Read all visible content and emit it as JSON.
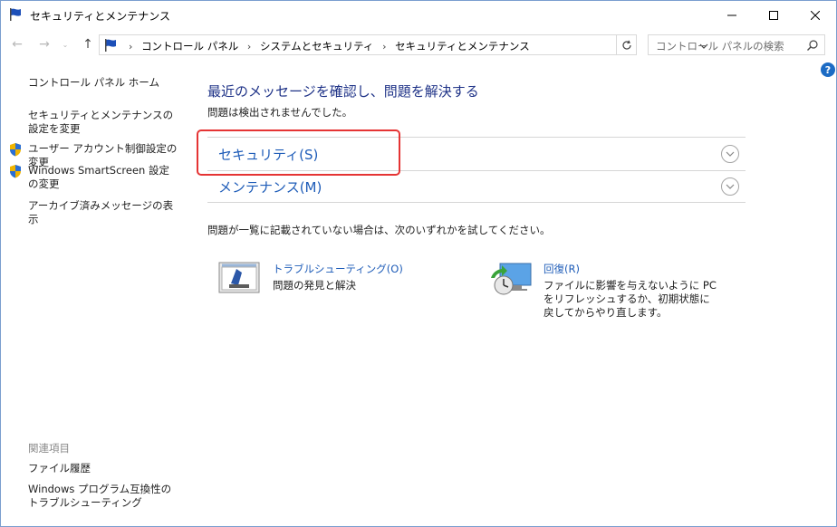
{
  "window": {
    "title": "セキュリティとメンテナンス"
  },
  "titlebar_buttons": {
    "minimize_glyph": "—",
    "maximize_glyph": "☐",
    "close_glyph": "✕"
  },
  "navigation": {
    "back_glyph": "←",
    "forward_glyph": "→",
    "recent_glyph": "⌄",
    "up_glyph": "↑",
    "breadcrumbs": [
      "コントロール パネル",
      "システムとセキュリティ",
      "セキュリティとメンテナンス"
    ],
    "breadcrumb_separator": "›",
    "search_placeholder": "コントロール パネルの検索"
  },
  "help": {
    "glyph": "?"
  },
  "sidebar": {
    "home": "コントロール パネル ホーム",
    "items": [
      {
        "label": "セキュリティとメンテナンスの設定を変更",
        "shield": false
      },
      {
        "label": "ユーザー アカウント制御設定の変更",
        "shield": true
      },
      {
        "label": "Windows SmartScreen 設定の変更",
        "shield": true
      },
      {
        "label": "アーカイブ済みメッセージの表示",
        "shield": false
      }
    ],
    "related_heading": "関連項目",
    "related": [
      "ファイル履歴",
      "Windows プログラム互換性のトラブルシューティング"
    ]
  },
  "main": {
    "title": "最近のメッセージを確認し、問題を解決する",
    "subtitle": "問題は検出されませんでした。",
    "sections": [
      {
        "label": "セキュリティ(S)"
      },
      {
        "label": "メンテナンス(M)"
      }
    ],
    "hint": "問題が一覧に記載されていない場合は、次のいずれかを試してください。",
    "tiles": [
      {
        "link": "トラブルシューティング(O)",
        "desc": "問題の発見と解決"
      },
      {
        "link": "回復(R)",
        "desc": "ファイルに影響を与えないように PC をリフレッシュするか、初期状態に戻してからやり直します。"
      }
    ]
  },
  "colors": {
    "title_blue": "#1e3287",
    "link_blue": "#1e5cb8",
    "highlight_red": "#e53434"
  }
}
